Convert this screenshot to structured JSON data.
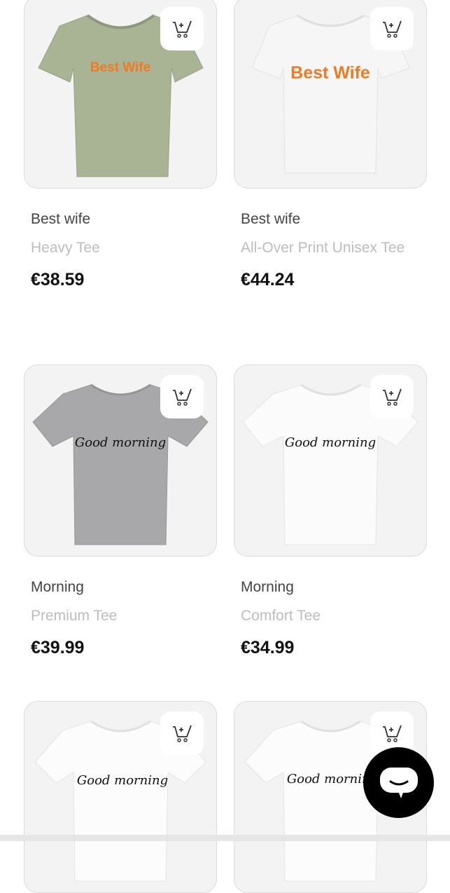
{
  "products": [
    {
      "name": "Best wife",
      "variant": "Heavy Tee",
      "price": "€38.59",
      "print_text": "Best Wife",
      "shirt_color": "#a9b495",
      "print_color": "#f07a22"
    },
    {
      "name": "Best wife",
      "variant": "All-Over Print Unisex Tee",
      "price": "€44.24",
      "print_text": "Best Wife",
      "shirt_color": "#f6f6f6",
      "print_color": "#f07a22"
    },
    {
      "name": "Morning",
      "variant": "Premium Tee",
      "price": "€39.99",
      "print_text": "Good morning",
      "shirt_color": "#a8a8aa",
      "print_color": "#111111"
    },
    {
      "name": "Morning",
      "variant": "Comfort Tee",
      "price": "€34.99",
      "print_text": "Good morning",
      "shirt_color": "#fbfbfb",
      "print_color": "#111111"
    },
    {
      "name": "",
      "variant": "",
      "price": "",
      "print_text": "Good morning",
      "shirt_color": "#fcfcfc",
      "print_color": "#111111"
    },
    {
      "name": "",
      "variant": "",
      "price": "",
      "print_text": "Good morning",
      "shirt_color": "#fcfcfc",
      "print_color": "#111111"
    }
  ],
  "icons": {
    "cart": "add-to-cart-icon",
    "chat": "chat-bubble-icon"
  }
}
